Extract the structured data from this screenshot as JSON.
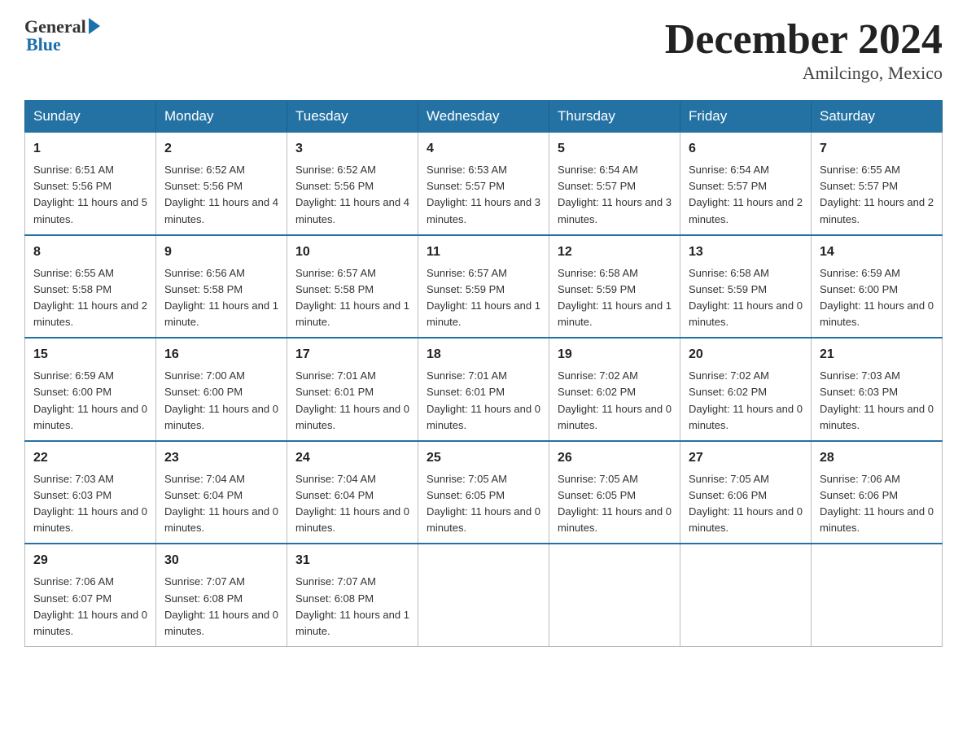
{
  "logo": {
    "general": "General",
    "blue": "Blue"
  },
  "title": "December 2024",
  "location": "Amilcingo, Mexico",
  "days_of_week": [
    "Sunday",
    "Monday",
    "Tuesday",
    "Wednesday",
    "Thursday",
    "Friday",
    "Saturday"
  ],
  "weeks": [
    [
      {
        "num": "1",
        "sunrise": "6:51 AM",
        "sunset": "5:56 PM",
        "daylight": "11 hours and 5 minutes."
      },
      {
        "num": "2",
        "sunrise": "6:52 AM",
        "sunset": "5:56 PM",
        "daylight": "11 hours and 4 minutes."
      },
      {
        "num": "3",
        "sunrise": "6:52 AM",
        "sunset": "5:56 PM",
        "daylight": "11 hours and 4 minutes."
      },
      {
        "num": "4",
        "sunrise": "6:53 AM",
        "sunset": "5:57 PM",
        "daylight": "11 hours and 3 minutes."
      },
      {
        "num": "5",
        "sunrise": "6:54 AM",
        "sunset": "5:57 PM",
        "daylight": "11 hours and 3 minutes."
      },
      {
        "num": "6",
        "sunrise": "6:54 AM",
        "sunset": "5:57 PM",
        "daylight": "11 hours and 2 minutes."
      },
      {
        "num": "7",
        "sunrise": "6:55 AM",
        "sunset": "5:57 PM",
        "daylight": "11 hours and 2 minutes."
      }
    ],
    [
      {
        "num": "8",
        "sunrise": "6:55 AM",
        "sunset": "5:58 PM",
        "daylight": "11 hours and 2 minutes."
      },
      {
        "num": "9",
        "sunrise": "6:56 AM",
        "sunset": "5:58 PM",
        "daylight": "11 hours and 1 minute."
      },
      {
        "num": "10",
        "sunrise": "6:57 AM",
        "sunset": "5:58 PM",
        "daylight": "11 hours and 1 minute."
      },
      {
        "num": "11",
        "sunrise": "6:57 AM",
        "sunset": "5:59 PM",
        "daylight": "11 hours and 1 minute."
      },
      {
        "num": "12",
        "sunrise": "6:58 AM",
        "sunset": "5:59 PM",
        "daylight": "11 hours and 1 minute."
      },
      {
        "num": "13",
        "sunrise": "6:58 AM",
        "sunset": "5:59 PM",
        "daylight": "11 hours and 0 minutes."
      },
      {
        "num": "14",
        "sunrise": "6:59 AM",
        "sunset": "6:00 PM",
        "daylight": "11 hours and 0 minutes."
      }
    ],
    [
      {
        "num": "15",
        "sunrise": "6:59 AM",
        "sunset": "6:00 PM",
        "daylight": "11 hours and 0 minutes."
      },
      {
        "num": "16",
        "sunrise": "7:00 AM",
        "sunset": "6:00 PM",
        "daylight": "11 hours and 0 minutes."
      },
      {
        "num": "17",
        "sunrise": "7:01 AM",
        "sunset": "6:01 PM",
        "daylight": "11 hours and 0 minutes."
      },
      {
        "num": "18",
        "sunrise": "7:01 AM",
        "sunset": "6:01 PM",
        "daylight": "11 hours and 0 minutes."
      },
      {
        "num": "19",
        "sunrise": "7:02 AM",
        "sunset": "6:02 PM",
        "daylight": "11 hours and 0 minutes."
      },
      {
        "num": "20",
        "sunrise": "7:02 AM",
        "sunset": "6:02 PM",
        "daylight": "11 hours and 0 minutes."
      },
      {
        "num": "21",
        "sunrise": "7:03 AM",
        "sunset": "6:03 PM",
        "daylight": "11 hours and 0 minutes."
      }
    ],
    [
      {
        "num": "22",
        "sunrise": "7:03 AM",
        "sunset": "6:03 PM",
        "daylight": "11 hours and 0 minutes."
      },
      {
        "num": "23",
        "sunrise": "7:04 AM",
        "sunset": "6:04 PM",
        "daylight": "11 hours and 0 minutes."
      },
      {
        "num": "24",
        "sunrise": "7:04 AM",
        "sunset": "6:04 PM",
        "daylight": "11 hours and 0 minutes."
      },
      {
        "num": "25",
        "sunrise": "7:05 AM",
        "sunset": "6:05 PM",
        "daylight": "11 hours and 0 minutes."
      },
      {
        "num": "26",
        "sunrise": "7:05 AM",
        "sunset": "6:05 PM",
        "daylight": "11 hours and 0 minutes."
      },
      {
        "num": "27",
        "sunrise": "7:05 AM",
        "sunset": "6:06 PM",
        "daylight": "11 hours and 0 minutes."
      },
      {
        "num": "28",
        "sunrise": "7:06 AM",
        "sunset": "6:06 PM",
        "daylight": "11 hours and 0 minutes."
      }
    ],
    [
      {
        "num": "29",
        "sunrise": "7:06 AM",
        "sunset": "6:07 PM",
        "daylight": "11 hours and 0 minutes."
      },
      {
        "num": "30",
        "sunrise": "7:07 AM",
        "sunset": "6:08 PM",
        "daylight": "11 hours and 0 minutes."
      },
      {
        "num": "31",
        "sunrise": "7:07 AM",
        "sunset": "6:08 PM",
        "daylight": "11 hours and 1 minute."
      },
      null,
      null,
      null,
      null
    ]
  ]
}
